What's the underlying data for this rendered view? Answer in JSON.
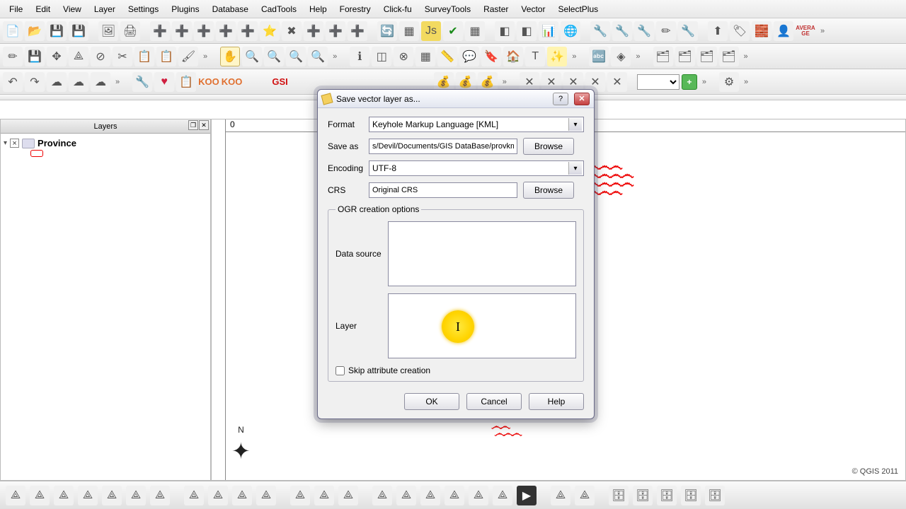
{
  "menu": [
    "File",
    "Edit",
    "View",
    "Layer",
    "Settings",
    "Plugins",
    "Database",
    "CadTools",
    "Help",
    "Forestry",
    "Click-fu",
    "SurveyTools",
    "Raster",
    "Vector",
    "SelectPlus"
  ],
  "layers_panel": {
    "title": "Layers",
    "item": "Province"
  },
  "canvas": {
    "ruler0": "0",
    "credit": "© QGIS 2011"
  },
  "dialog": {
    "title": "Save vector layer as...",
    "format_lbl": "Format",
    "format_val": "Keyhole Markup Language [KML]",
    "saveas_lbl": "Save as",
    "saveas_val": "s/Devil/Documents/GIS DataBase/provkml.kml",
    "browse": "Browse",
    "encoding_lbl": "Encoding",
    "encoding_val": "UTF-8",
    "crs_lbl": "CRS",
    "crs_val": "Original CRS",
    "ogr_legend": "OGR creation options",
    "datasource_lbl": "Data source",
    "layer_lbl": "Layer",
    "skip_lbl": "Skip attribute creation",
    "ok": "OK",
    "cancel": "Cancel",
    "help": "Help"
  },
  "row3": {
    "koo": "KOO",
    "gsi": "GSI",
    "avg": "AVERA\nGE"
  }
}
